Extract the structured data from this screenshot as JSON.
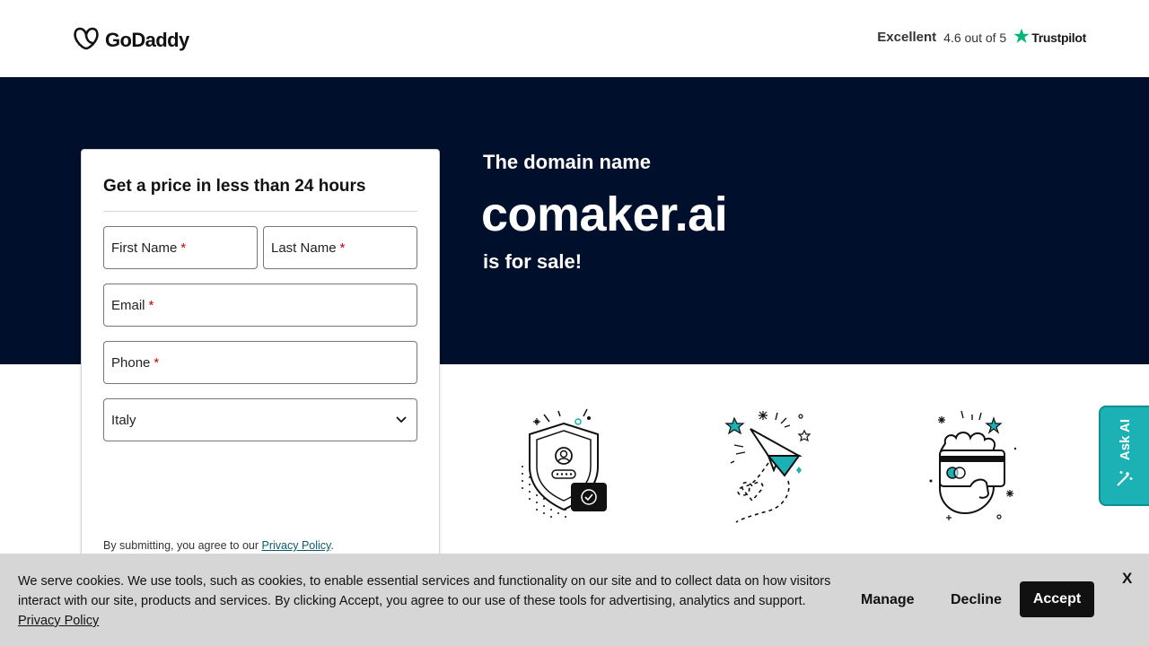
{
  "header": {
    "logo_text": "GoDaddy",
    "rating_label": "Excellent",
    "rating_score": "4.6 out of 5",
    "trustpilot_label": "Trustpilot"
  },
  "hero": {
    "kicker": "The domain name",
    "domain": "comaker.ai",
    "suffix": "is for sale!"
  },
  "form": {
    "title": "Get a price in less than 24 hours",
    "first_name_label": "First Name",
    "last_name_label": "Last Name",
    "email_label": "Email",
    "phone_label": "Phone",
    "required_mark": "*",
    "country_value": "Italy",
    "disclaimer_prefix": "By submitting, you agree to our",
    "privacy_link": "Privacy Policy",
    "disclaimer_suffix": "."
  },
  "icons": {
    "logo": "godaddy-logo-icon",
    "star": "trustpilot-star-icon",
    "chevron": "chevron-down-icon",
    "illus_1": "shield-user-icon",
    "illus_2": "paper-plane-icon",
    "illus_3": "card-hand-icon",
    "askai": "magic-wand-icon"
  },
  "askai": {
    "label": "Ask AI"
  },
  "cookie": {
    "text_line1": "We serve cookies. We use tools, such as cookies, to enable essential services and functionality on our site and to collect data on how visitors",
    "text_line2": "interact with our site, products and services. By clicking Accept, you agree to our use of these tools for advertising, analytics and support.",
    "privacy_link": "Privacy Policy",
    "manage_label": "Manage",
    "decline_label": "Decline",
    "accept_label": "Accept",
    "close_label": "X"
  },
  "colors": {
    "hero_bg": "#000f2b",
    "accent_teal": "#1bb1b5",
    "trustpilot_green": "#00b67a",
    "required_red": "#cc0000",
    "cookie_bg": "#d6d6d6"
  }
}
